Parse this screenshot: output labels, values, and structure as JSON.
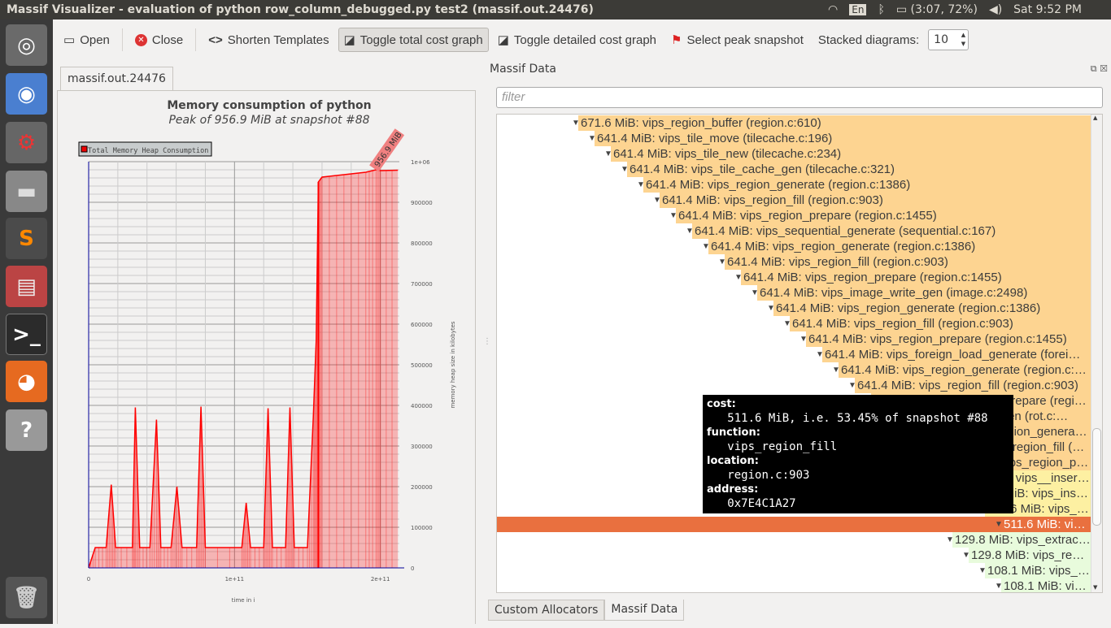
{
  "window": {
    "title": "Massif Visualizer - evaluation of python row_column_debugged.py test2 (massif.out.24476)"
  },
  "tray": {
    "keyboard": "En",
    "battery": "(3:07, 72%)",
    "clock": "Sat  9:52 PM"
  },
  "toolbar": {
    "open": "Open",
    "close": "Close",
    "shorten": "Shorten Templates",
    "toggle_total": "Toggle total cost graph",
    "toggle_detailed": "Toggle detailed cost graph",
    "select_peak": "Select peak snapshot",
    "stacked_label": "Stacked diagrams:",
    "stacked_value": "10"
  },
  "left": {
    "tab": "massif.out.24476"
  },
  "chart_data": {
    "type": "area",
    "title": "Memory consumption of python",
    "subtitle": "Peak of 956.9 MiB at snapshot #88",
    "legend": [
      "Total Memory Heap Consumption"
    ],
    "legend_position": "top-left",
    "xlabel": "time in i",
    "ylabel": "memory heap size in kilobytes",
    "xlim": [
      0,
      213000000000.0
    ],
    "ylim": [
      0,
      1000000
    ],
    "xticks": [
      "0",
      "1e+11",
      "2e+11"
    ],
    "yticks": [
      "0",
      "100000",
      "200000",
      "300000",
      "400000",
      "500000",
      "600000",
      "700000",
      "800000",
      "900000",
      "1e+06"
    ],
    "grid": true,
    "color": "#ff0000",
    "peak_label": "956.9 MiB",
    "peak": {
      "x": 197000000000.0,
      "y": 979866
    },
    "x": [
      0,
      4500000000.0,
      12000000000.0,
      15500000000.0,
      18500000000.0,
      30000000000.0,
      32000000000.0,
      35000000000.0,
      42000000000.0,
      46500000000.0,
      49500000000.0,
      56500000000.0,
      60500000000.0,
      64000000000.0,
      74000000000.0,
      77000000000.0,
      80000000000.0,
      105000000000.0,
      108000000000.0,
      111000000000.0,
      120000000000.0,
      123000000000.0,
      126000000000.0,
      135000000000.0,
      138000000000.0,
      141000000000.0,
      150000000000.0,
      154000000000.0,
      156000000000.0,
      157500000000.0,
      160000000000.0,
      175000000000.0,
      190000000000.0,
      197000000000.0,
      200000000000.0,
      212000000000.0
    ],
    "y": [
      0,
      50000,
      50000,
      205000,
      50000,
      50000,
      395000,
      50000,
      50000,
      365000,
      50000,
      50000,
      200000,
      50000,
      50000,
      397000,
      50000,
      50000,
      160000,
      50000,
      50000,
      393000,
      50000,
      50000,
      395000,
      50000,
      50000,
      370000,
      560000,
      950000,
      962000,
      968000,
      974000,
      979866,
      978000,
      979000
    ]
  },
  "right": {
    "title": "Massif Data",
    "filter_placeholder": "filter",
    "rows": [
      {
        "text": "671.6 MiB: vips_region_buffer (region.c:610)",
        "depth": 0,
        "kind": "peak"
      },
      {
        "text": "641.4 MiB: vips_tile_move (tilecache.c:196)",
        "depth": 1,
        "kind": "peak"
      },
      {
        "text": "641.4 MiB: vips_tile_new (tilecache.c:234)",
        "depth": 2,
        "kind": "peak"
      },
      {
        "text": "641.4 MiB: vips_tile_cache_gen (tilecache.c:321)",
        "depth": 3,
        "kind": "peak"
      },
      {
        "text": "641.4 MiB: vips_region_generate (region.c:1386)",
        "depth": 4,
        "kind": "peak"
      },
      {
        "text": "641.4 MiB: vips_region_fill (region.c:903)",
        "depth": 5,
        "kind": "peak"
      },
      {
        "text": "641.4 MiB: vips_region_prepare (region.c:1455)",
        "depth": 6,
        "kind": "peak"
      },
      {
        "text": "641.4 MiB: vips_sequential_generate (sequential.c:167)",
        "depth": 7,
        "kind": "peak"
      },
      {
        "text": "641.4 MiB: vips_region_generate (region.c:1386)",
        "depth": 8,
        "kind": "peak"
      },
      {
        "text": "641.4 MiB: vips_region_fill (region.c:903)",
        "depth": 9,
        "kind": "peak"
      },
      {
        "text": "641.4 MiB: vips_region_prepare (region.c:1455)",
        "depth": 10,
        "kind": "peak"
      },
      {
        "text": "641.4 MiB: vips_image_write_gen (image.c:2498)",
        "depth": 11,
        "kind": "peak"
      },
      {
        "text": "641.4 MiB: vips_region_generate (region.c:1386)",
        "depth": 12,
        "kind": "peak"
      },
      {
        "text": "641.4 MiB: vips_region_fill (region.c:903)",
        "depth": 13,
        "kind": "peak"
      },
      {
        "text": "641.4 MiB: vips_region_prepare (region.c:1455)",
        "depth": 14,
        "kind": "peak"
      },
      {
        "text": "641.4 MiB: vips_foreign_load_generate (forei…",
        "depth": 15,
        "kind": "peak"
      },
      {
        "text": "641.4 MiB: vips_region_generate (region.c:1386)",
        "depth": 16,
        "kind": "peak"
      },
      {
        "text": "641.4 MiB: vips_region_fill (region.c:903)",
        "depth": 17,
        "kind": "peak"
      },
      {
        "text": "641.4 MiB: vips_region_prepare (regi…",
        "depth": 18,
        "kind": "peak"
      },
      {
        "text": "641.4 MiB: vips_rot_gen (rot.c:…",
        "depth": 19,
        "kind": "peak"
      },
      {
        "text": "641.4 MiB: vips_region_genera…",
        "depth": 20,
        "kind": "peak"
      },
      {
        "text": "641.4 MiB: vips_region_fill (…",
        "depth": 21,
        "kind": "peak"
      },
      {
        "text": "641.4 MiB: vips_region_p…",
        "depth": 22,
        "kind": "peak"
      },
      {
        "text": "511.6 MiB: vips__inser…",
        "depth": 23,
        "kind": "mid"
      },
      {
        "text": "511.6 MiB: vips_ins…",
        "depth": 24,
        "kind": "mid"
      },
      {
        "text": "511.6 MiB: vips_…",
        "depth": 25,
        "kind": "mid"
      },
      {
        "text": "511.6 MiB: vi…",
        "depth": 26,
        "kind": "selected"
      },
      {
        "text": "129.8 MiB: vips_extrac…",
        "depth": 23,
        "kind": "low"
      },
      {
        "text": "129.8 MiB: vips_reg…",
        "depth": 24,
        "kind": "low"
      },
      {
        "text": "108.1 MiB: vips_…",
        "depth": 25,
        "kind": "low"
      },
      {
        "text": "108.1 MiB: vi…",
        "depth": 26,
        "kind": "low"
      }
    ],
    "colors": {
      "peak": "#fdd491",
      "mid": "#fdf0a2",
      "selected": "#e9703f",
      "low": "#e8fbdc"
    },
    "tooltip": {
      "cost_label": "cost:",
      "cost": "511.6 MiB, i.e. 53.45% of snapshot #88",
      "function_label": "function:",
      "function": "vips_region_fill",
      "location_label": "location:",
      "location": "region.c:903",
      "address_label": "address:",
      "address": "0x7E4C1A27"
    },
    "bottom_tabs": [
      "Custom Allocators",
      "Massif Data"
    ]
  }
}
